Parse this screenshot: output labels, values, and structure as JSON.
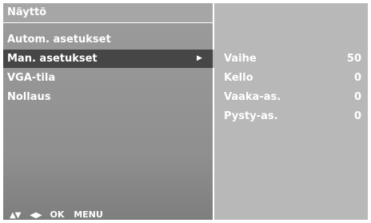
{
  "window": {
    "title": "Näyttö"
  },
  "menu": {
    "items": [
      {
        "label": "Autom. asetukset",
        "selected": false
      },
      {
        "label": "Man. asetukset",
        "selected": true,
        "submenu_icon": "right-triangle-icon"
      },
      {
        "label": "VGA-tila",
        "selected": false
      },
      {
        "label": "Nollaus",
        "selected": false
      }
    ]
  },
  "submenu": {
    "params": [
      {
        "label": "Vaihe",
        "value": "50"
      },
      {
        "label": "Kello",
        "value": "0"
      },
      {
        "label": "Vaaka-as.",
        "value": "0"
      },
      {
        "label": "Pysty-as.",
        "value": "0"
      }
    ]
  },
  "footer": {
    "nav_updown": "▲▼",
    "nav_leftright": "◀▶",
    "ok_label": "OK",
    "menu_label": "MENU"
  },
  "colors": {
    "panel_background": "#8f8f8f",
    "submenu_background": "#b8b8b8",
    "selected_row": "#464646",
    "text": "#ffffff"
  }
}
